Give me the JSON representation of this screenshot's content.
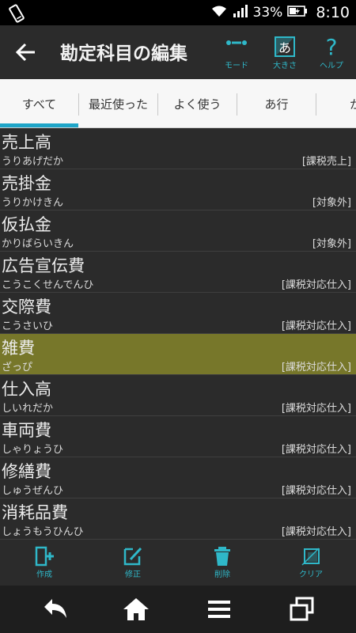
{
  "status_bar": {
    "battery_percent": "33%",
    "time": "8:10"
  },
  "action_bar": {
    "title": "勘定科目の編集",
    "actions": [
      {
        "label": "モード",
        "icon": "mode-icon"
      },
      {
        "label": "大きさ",
        "icon": "text-size-icon"
      },
      {
        "label": "ヘルプ",
        "icon": "help-icon"
      }
    ]
  },
  "tabs": [
    {
      "label": "すべて",
      "selected": true
    },
    {
      "label": "最近使った",
      "selected": false
    },
    {
      "label": "よく使う",
      "selected": false
    },
    {
      "label": "あ行",
      "selected": false
    },
    {
      "label": "か",
      "selected": false
    }
  ],
  "accounts": [
    {
      "name": "売上高",
      "reading": "うりあげだか",
      "tax": "[課税売上]",
      "selected": false
    },
    {
      "name": "売掛金",
      "reading": "うりかけきん",
      "tax": "[対象外]",
      "selected": false
    },
    {
      "name": "仮払金",
      "reading": "かりばらいきん",
      "tax": "[対象外]",
      "selected": false
    },
    {
      "name": "広告宣伝費",
      "reading": "こうこくせんでんひ",
      "tax": "[課税対応仕入]",
      "selected": false
    },
    {
      "name": "交際費",
      "reading": "こうさいひ",
      "tax": "[課税対応仕入]",
      "selected": false
    },
    {
      "name": "雑費",
      "reading": "ざっぴ",
      "tax": "[課税対応仕入]",
      "selected": true
    },
    {
      "name": "仕入高",
      "reading": "しいれだか",
      "tax": "[課税対応仕入]",
      "selected": false
    },
    {
      "name": "車両費",
      "reading": "しゃりょうひ",
      "tax": "[課税対応仕入]",
      "selected": false
    },
    {
      "name": "修繕費",
      "reading": "しゅうぜんひ",
      "tax": "[課税対応仕入]",
      "selected": false
    },
    {
      "name": "消耗品費",
      "reading": "しょうもうひんひ",
      "tax": "[課税対応仕入]",
      "selected": false
    }
  ],
  "toolbar": [
    {
      "label": "作成",
      "icon": "create-icon"
    },
    {
      "label": "修正",
      "icon": "edit-icon"
    },
    {
      "label": "削除",
      "icon": "trash-icon"
    },
    {
      "label": "クリア",
      "icon": "clear-icon"
    }
  ],
  "colors": {
    "accent": "#1ea5c8",
    "icon_teal": "#2fb8c9",
    "selected_row": "#77772a",
    "background": "#2b2b2b"
  }
}
